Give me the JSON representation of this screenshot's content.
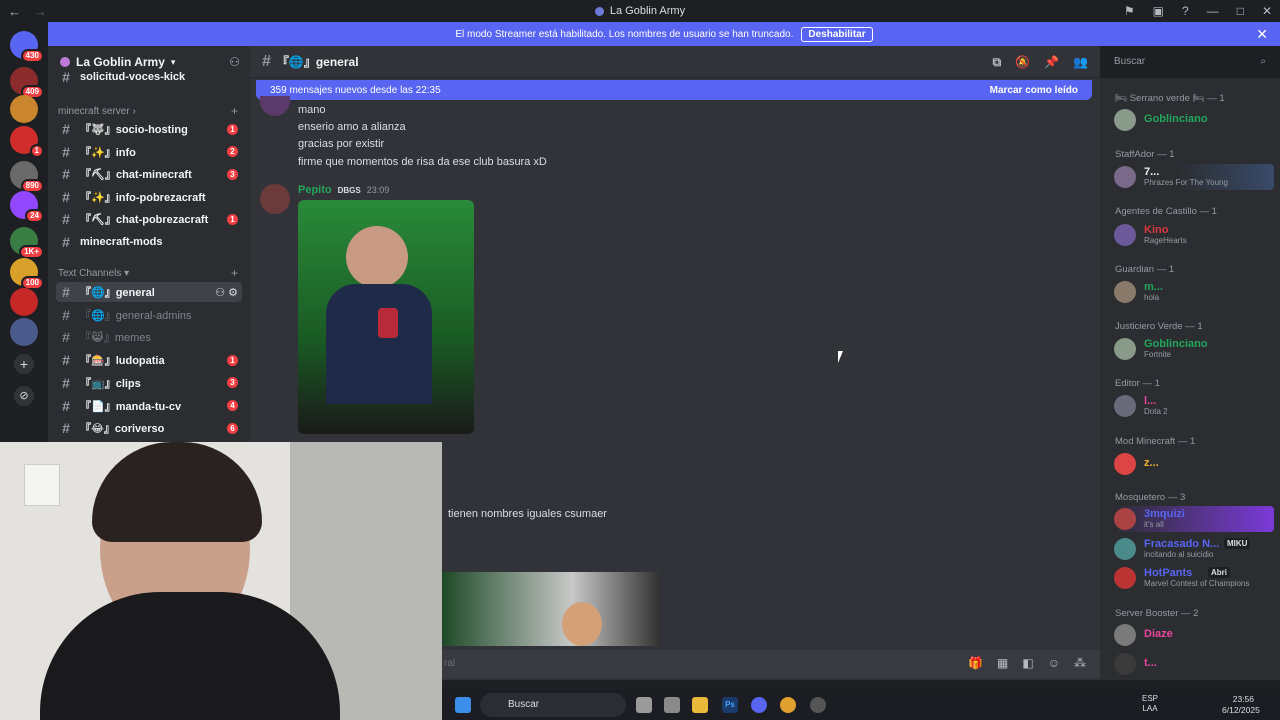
{
  "window": {
    "title": "La Goblin Army"
  },
  "banner": {
    "text": "El modo Streamer está habilitado. Los nombres de usuario se han truncado.",
    "button": "Deshabilitar"
  },
  "server": {
    "name": "La Goblin Army"
  },
  "servers": [
    {
      "badge": "430",
      "color": "#5865f2"
    },
    {
      "badge": "409",
      "color": "#8b2b2b"
    },
    {
      "badge": "",
      "color": "#c9862c"
    },
    {
      "badge": "1",
      "color": "#d12d2d"
    },
    {
      "badge": "890",
      "color": "#6a6a6a"
    },
    {
      "badge": "24",
      "color": "#9146ff"
    },
    {
      "badge": "1K+",
      "color": "#3a7d44"
    },
    {
      "badge": "100",
      "color": "#d8a02a"
    },
    {
      "badge": "",
      "color": "#c62828"
    },
    {
      "badge": "",
      "color": "#4a5a8a"
    }
  ],
  "sidebar": {
    "top_channel": "solicitud-voces-kick",
    "cat1": "minecraft server",
    "cat1_channels": [
      {
        "name": "『🐺』socio-hosting",
        "badge": "1"
      },
      {
        "name": "『✨』info",
        "badge": "2"
      },
      {
        "name": "『⛏』chat-minecraft",
        "badge": "3"
      },
      {
        "name": "『✨』info-pobrezacraft",
        "badge": ""
      },
      {
        "name": "『⛏』chat-pobrezacraft",
        "badge": "1"
      }
    ],
    "minecraft_mods": "minecraft-mods",
    "cat2": "Text Channels",
    "cat2_channels": [
      {
        "name": "『🌐』general",
        "badge": ""
      },
      {
        "name": "『🌐』general-admins",
        "badge": ""
      },
      {
        "name": "『😹』memes",
        "badge": ""
      },
      {
        "name": "『🎰』ludopatia",
        "badge": "1"
      },
      {
        "name": "『📺』clips",
        "badge": "3"
      },
      {
        "name": "『📄』manda-tu-cv",
        "badge": "4"
      },
      {
        "name": "『😂』coriverso",
        "badge": "6"
      }
    ]
  },
  "chat": {
    "channel": "『🌐』general",
    "new_messages": "359 mensajes nuevos desde las 22:35",
    "mark_read": "Marcar como leído",
    "lines": [
      "mano",
      "enserio amo a alianza",
      "gracias por existir",
      "firme que momentos de risa da ese club basura xD"
    ],
    "author": "Pepito",
    "author_tag": "DBGS",
    "time": "23:09",
    "partial": "tienen nombres iguales csumaer",
    "input_hint": "ral"
  },
  "search": {
    "placeholder": "Buscar"
  },
  "members": [
    {
      "role": "🛏 Serrano verde 🛏 — 1",
      "name": "Goblinciano",
      "status": "",
      "color": "#23a55a"
    },
    {
      "role": "StaffAdor — 1",
      "name": "7...",
      "status": "Phrazes For The Young",
      "color": "#f2f3f5"
    },
    {
      "role": "Agentes de Castillo — 1",
      "name": "Kino",
      "status": "RageHearts",
      "color": "#da373c"
    },
    {
      "role": "Guardian — 1",
      "name": "m...",
      "status": "hola",
      "color": "#23a55a"
    },
    {
      "role": "Justiciero Verde — 1",
      "name": "Goblinciano",
      "status": "Fortnite",
      "color": "#23a55a"
    },
    {
      "role": "Editor — 1",
      "name": "l...",
      "status": "Dota 2",
      "color": "#eb459e"
    },
    {
      "role": "Mod Minecraft — 1",
      "name": "z...",
      "status": "",
      "color": "#f0b232"
    },
    {
      "role": "Mosquetero — 3",
      "name": "3mquizi",
      "status": "it's all",
      "color": "#5865f2"
    },
    {
      "role": "",
      "name": "Fracasado N...",
      "status": "incitando al suicidio",
      "color": "#5865f2"
    },
    {
      "role": "",
      "name": "HotPants",
      "status": "Marvel Contest of Champions",
      "color": "#5865f2"
    },
    {
      "role": "Server Booster — 2",
      "name": "Diaze",
      "status": "",
      "color": "#eb459e"
    },
    {
      "role": "",
      "name": "t...",
      "status": "",
      "color": "#eb459e"
    }
  ],
  "member_tags": {
    "miku": "MIKU",
    "abri": "Abri"
  },
  "taskbar": {
    "search": "Buscar",
    "lang": "ESP",
    "lang2": "LAA",
    "time": "23:56",
    "date": "6/12/2025"
  }
}
